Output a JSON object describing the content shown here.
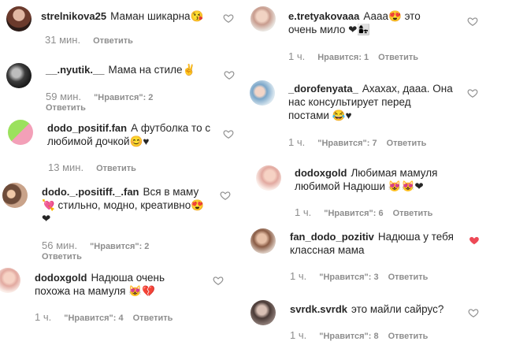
{
  "left": [
    {
      "user": "strelnikova25",
      "text": "Маман шикарна😘",
      "time": "31 мин.",
      "likes": "",
      "reply": "Ответить"
    },
    {
      "user": "__.nyutik.__",
      "text": "Мама на стиле✌",
      "time": "59 мин.",
      "likes": "\"Нравится\": 2",
      "reply": "Ответить"
    },
    {
      "user": "dodo_positif.fan",
      "text": "А футболка то с любимой дочкой😊♥",
      "time": "13 мин.",
      "likes": "",
      "reply": "Ответить"
    },
    {
      "user": "dodo._.positiff._.fan",
      "text": "Вся в маму 💘 стильно, модно, креативно😍 ❤",
      "time": "56 мин.",
      "likes": "\"Нравится\": 2",
      "reply": "Ответить"
    },
    {
      "user": "dodoxgold",
      "text": "Надюша очень похожа на мамуля 😻💔",
      "time": "1 ч.",
      "likes": "\"Нравится\": 4",
      "reply": "Ответить"
    }
  ],
  "right": [
    {
      "user": "e.tretyakovaaa",
      "text": "Аааа😍 это очень мило ❤👩‍👧",
      "time": "1 ч.",
      "likes": "Нравится: 1",
      "reply": "Ответить"
    },
    {
      "user": "_dorofenyata_",
      "text": "Ахахах, дааа. Она нас консультирует перед постами 😂♥",
      "time": "1 ч.",
      "likes": "\"Нравится\": 7",
      "reply": "Ответить"
    },
    {
      "user": "dodoxgold",
      "text": "Любимая мамуля любимой Надюши 😻😻❤",
      "time": "1 ч.",
      "likes": "\"Нравится\": 6",
      "reply": "Ответить"
    },
    {
      "user": "fan_dodo_pozitiv",
      "text": "Надюша у тебя классная мама",
      "time": "1 ч.",
      "likes": "\"Нравится\": 3",
      "reply": "Ответить"
    },
    {
      "user": "svrdk.svrdk",
      "text": "это майли сайрус?",
      "time": "1 ч.",
      "likes": "\"Нравится\": 8",
      "reply": "Ответить"
    }
  ],
  "colors": {
    "text": "#262626",
    "meta": "#8e8e8e",
    "heart_liked": "#ed4956"
  },
  "icons": {
    "heart_outline": "heart-outline-icon",
    "heart_liked": "heart-filled-icon"
  }
}
